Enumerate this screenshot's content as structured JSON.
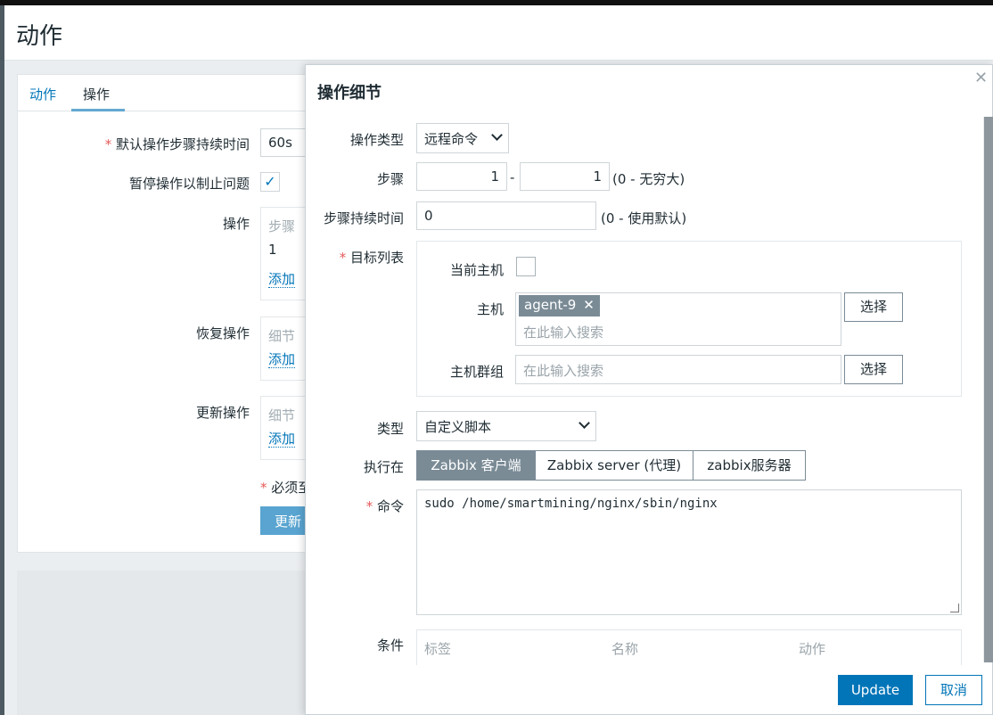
{
  "page": {
    "title": "动作"
  },
  "tabs": [
    {
      "label": "动作"
    },
    {
      "label": "操作"
    }
  ],
  "background_form": {
    "default_duration_label": "默认操作步骤持续时间",
    "default_duration_value": "60s",
    "pause_label": "暂停操作以制止问题",
    "pause_checked": true,
    "operations_label": "操作",
    "operations_head": "步骤",
    "operations_value": "1",
    "operations_add": "添加",
    "recovery_label": "恢复操作",
    "recovery_head": "细节",
    "recovery_add": "添加",
    "update_ops_label": "更新操作",
    "update_ops_head": "细节",
    "update_ops_add": "添加",
    "required_note": "必须至",
    "update_button": "更新"
  },
  "dialog": {
    "title": "操作细节",
    "close_icon": "close-icon",
    "operation_type_label": "操作类型",
    "operation_type_value": "远程命令",
    "steps_label": "步骤",
    "step_from": "1",
    "step_sep": "-",
    "step_to": "1",
    "steps_hint": "(0 - 无穷大)",
    "step_duration_label": "步骤持续时间",
    "step_duration_value": "0",
    "step_duration_hint": "(0 - 使用默认)",
    "target_list_label": "目标列表",
    "current_host_label": "当前主机",
    "host_label": "主机",
    "host_tag": "agent-9",
    "host_placeholder": "在此输入搜索",
    "host_select_button": "选择",
    "host_group_label": "主机群组",
    "host_group_placeholder": "在此输入搜索",
    "host_group_select_button": "选择",
    "type_label": "类型",
    "type_value": "自定义脚本",
    "execute_on_label": "执行在",
    "execute_on_options": [
      "Zabbix 客户端",
      "Zabbix server (代理)",
      "zabbix服务器"
    ],
    "execute_on_selected": "Zabbix 客户端",
    "command_label": "命令",
    "command_value": "sudo /home/smartmining/nginx/sbin/nginx",
    "conditions_label": "条件",
    "conditions_headers": [
      "标签",
      "名称",
      "动作"
    ],
    "update_button": "Update",
    "cancel_button": "取消"
  },
  "colors": {
    "accent": "#0275b8",
    "required": "#e45959",
    "segment_active": "#7a8b96"
  }
}
